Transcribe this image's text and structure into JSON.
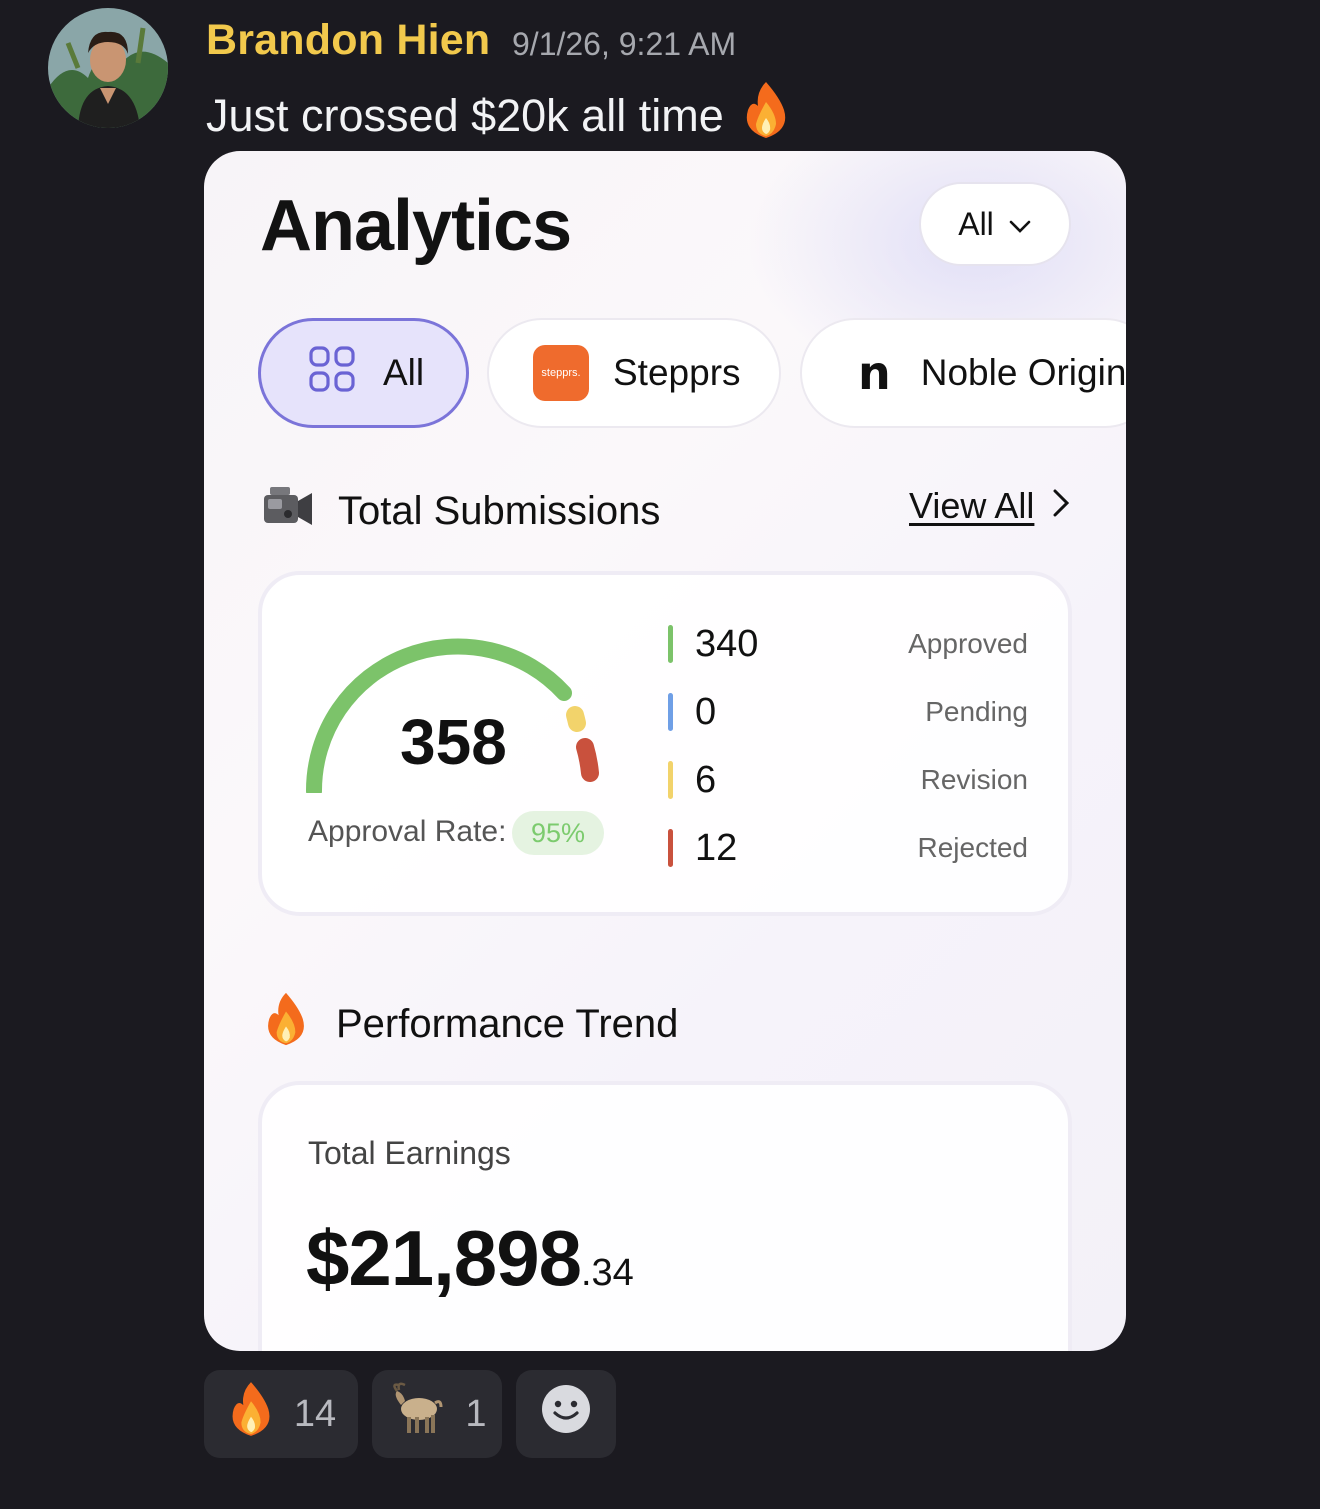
{
  "message": {
    "author": "Brandon Hien",
    "timestamp": "9/1/26, 9:21 AM",
    "text": "Just crossed $20k all time",
    "emoji_icon": "fire-icon"
  },
  "analytics": {
    "title": "Analytics",
    "filter_label": "All",
    "tabs": [
      {
        "label": "All",
        "icon": "grid-icon"
      },
      {
        "label": "Stepprs",
        "logo_text": "stepprs."
      },
      {
        "label": "Noble Origins",
        "logo_text": "n"
      }
    ],
    "submissions": {
      "title": "Total Submissions",
      "icon": "video-camera-icon",
      "view_all": "View All",
      "total": "358",
      "approval_label": "Approval Rate:",
      "approval_rate": "95%",
      "stats": [
        {
          "value": "340",
          "label": "Approved",
          "color": "#7cc36a"
        },
        {
          "value": "0",
          "label": "Pending",
          "color": "#6f9fe6"
        },
        {
          "value": "6",
          "label": "Revision",
          "color": "#f2d36b"
        },
        {
          "value": "12",
          "label": "Rejected",
          "color": "#c9513d"
        }
      ]
    },
    "performance": {
      "title": "Performance Trend",
      "icon": "fire-icon",
      "earnings_label": "Total Earnings",
      "earnings_main": "$21,898",
      "earnings_cents": ".34"
    }
  },
  "reactions": [
    {
      "icon": "fire-icon",
      "count": "14"
    },
    {
      "icon": "goat-icon",
      "count": "1"
    },
    {
      "icon": "add-reaction-icon",
      "count": ""
    }
  ]
}
